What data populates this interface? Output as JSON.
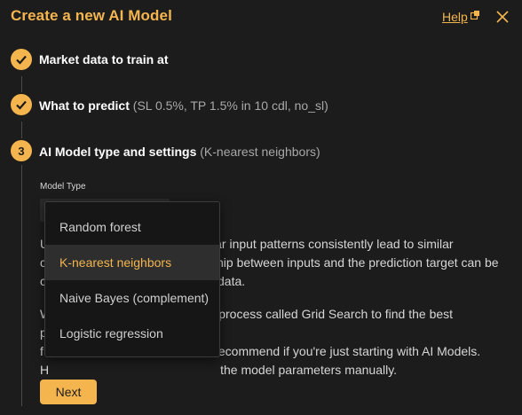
{
  "dialog": {
    "title": "Create a new AI Model",
    "help_label": "Help",
    "accent_color": "#f4b54f"
  },
  "steps": [
    {
      "status": "done",
      "icon": "checkmark-icon",
      "label": "Market data to train at",
      "detail": ""
    },
    {
      "status": "done",
      "icon": "checkmark-icon",
      "label": "What to predict",
      "detail": "(SL 0.5%, TP 1.5% in 10 cdl, no_sl)"
    },
    {
      "status": "current",
      "number": "3",
      "label": "AI Model type and settings",
      "detail": "(K-nearest neighbors)"
    }
  ],
  "model_type": {
    "label": "Model Type",
    "options": [
      "Random forest",
      "K-nearest neighbors",
      "Naive Bayes (complement)",
      "Logistic regression"
    ],
    "selected": "K-nearest neighbors"
  },
  "description": {
    "p1_line1_start": "U",
    "p1_line1_end": "ar input patterns consistently lead to similar",
    "p1_line2_start": "c",
    "p1_line2_end": "hip between inputs and the prediction target can be",
    "p1_line3_start": "c",
    "p1_line3_end": "data.",
    "p2_line1_start": "W",
    "p2_line1_end": "process called Grid Search to find the best parameters",
    "p2_line2_start": "f",
    "p2_line2_end": "ecommend if you're just starting with AI Models.",
    "p2_line3_start": "H",
    "p2_line3_end": "the model parameters manually."
  },
  "actions": {
    "next_label": "Next"
  }
}
